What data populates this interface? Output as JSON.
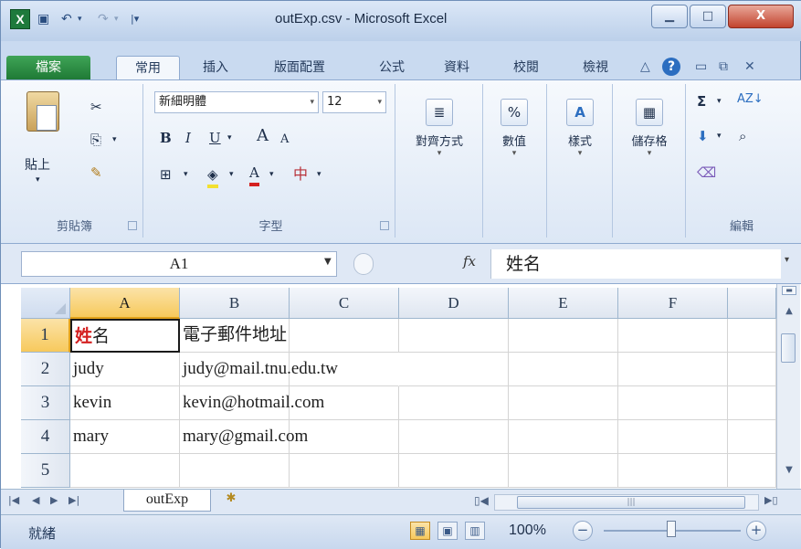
{
  "window": {
    "title": "outExp.csv - Microsoft Excel",
    "app_icon_label": "X",
    "minimize": "▁",
    "maximize": "□",
    "close": "X"
  },
  "quick_access": {
    "save_icon": "save-icon",
    "undo_icon": "undo-icon",
    "redo_icon": "redo-icon",
    "customize_icon": "customize-icon"
  },
  "tabs": [
    {
      "label": "檔案"
    },
    {
      "label": "常用"
    },
    {
      "label": "插入"
    },
    {
      "label": "版面配置"
    },
    {
      "label": "公式"
    },
    {
      "label": "資料"
    },
    {
      "label": "校閱"
    },
    {
      "label": "檢視"
    }
  ],
  "ribbon": {
    "clipboard": {
      "label": "剪貼簿",
      "paste": "貼上"
    },
    "font": {
      "label": "字型",
      "font_name": "新細明體",
      "font_size": "12",
      "bold": "B",
      "italic": "I",
      "underline": "U",
      "grow": "A",
      "shrink": "A",
      "phonetic": "中"
    },
    "alignment": {
      "label": "對齊方式"
    },
    "number": {
      "label": "數值",
      "icon_text": "%"
    },
    "styles": {
      "label": "樣式"
    },
    "cells": {
      "label": "儲存格"
    },
    "editing": {
      "label": "編輯"
    }
  },
  "formula_bar": {
    "name_box": "A1",
    "fx_label": "fx",
    "formula": "姓名"
  },
  "columns": [
    "A",
    "B",
    "C",
    "D",
    "E",
    "F"
  ],
  "rows": [
    {
      "num": "1",
      "a_first": "姓",
      "a_rest": "名",
      "b": "電子郵件地址"
    },
    {
      "num": "2",
      "a": "judy",
      "b": "judy@mail.tnu.edu.tw"
    },
    {
      "num": "3",
      "a": "kevin",
      "b": "kevin@hotmail.com"
    },
    {
      "num": "4",
      "a": "mary",
      "b": "mary@gmail.com"
    },
    {
      "num": "5",
      "a": "",
      "b": ""
    }
  ],
  "sheet_tabs": [
    {
      "label": "outExp"
    }
  ],
  "status_bar": {
    "ready": "就緒",
    "zoom": "100%",
    "zoom_out": "−",
    "zoom_in": "+"
  },
  "colors": {
    "file_tab": "#1f7a35",
    "selection_header": "#f7c95c",
    "highlight_char": "#d42020"
  }
}
